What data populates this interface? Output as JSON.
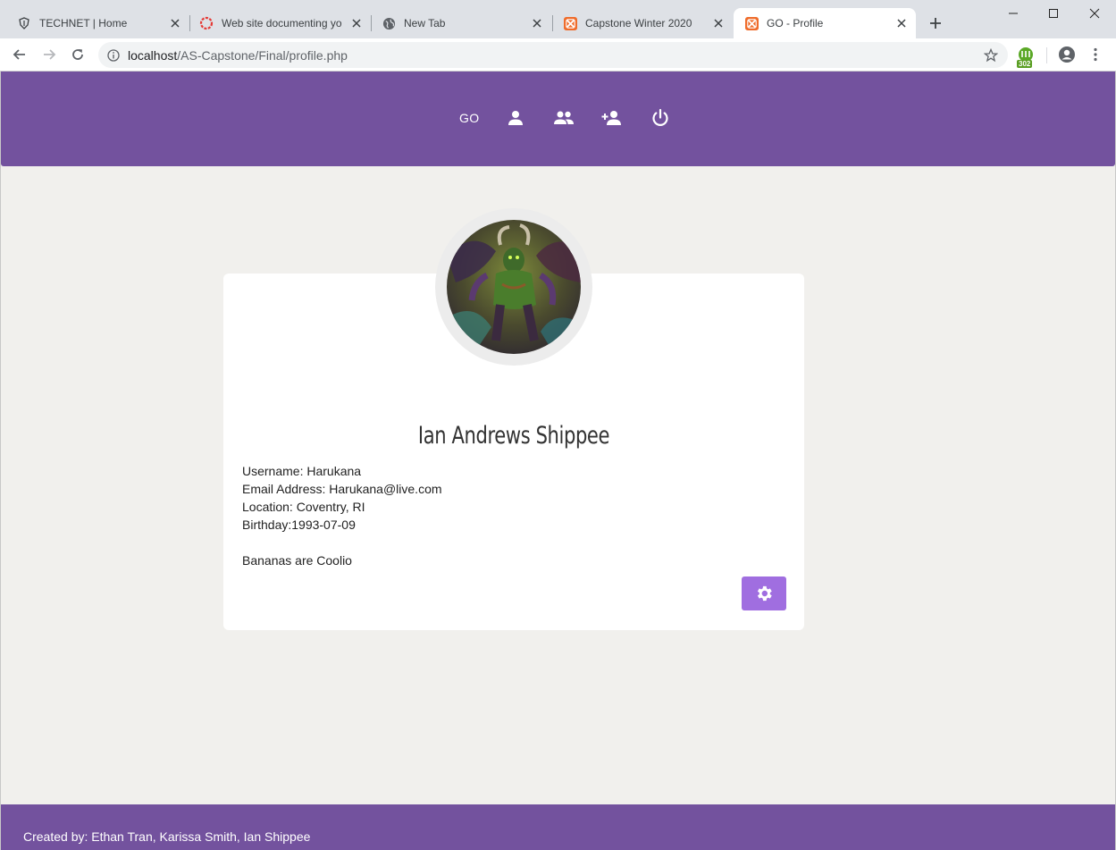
{
  "browser": {
    "tabs": [
      {
        "title": "TECHNET | Home",
        "favicon": "shield-icon",
        "active": false
      },
      {
        "title": "Web site documenting yo",
        "favicon": "ring-icon",
        "active": false
      },
      {
        "title": "New Tab",
        "favicon": "globe-icon",
        "active": false
      },
      {
        "title": "Capstone Winter 2020",
        "favicon": "xampp-icon",
        "active": false
      },
      {
        "title": "GO - Profile",
        "favicon": "xampp-icon",
        "active": true
      }
    ],
    "address": {
      "host": "localhost",
      "path": "/AS-Capstone/Final/profile.php"
    },
    "extension_badge": "302"
  },
  "nav": {
    "brand": "GO",
    "icons": [
      "profile-icon",
      "friends-icon",
      "add-friend-icon",
      "power-icon"
    ]
  },
  "profile": {
    "name": "Ian Andrews Shippee",
    "username_line": "Username: Harukana",
    "email_line": "Email Address: Harukana@live.com",
    "location_line": "Location: Coventry, RI",
    "birthday_line": "Birthday:1993-07-09",
    "bio": "Bananas are Coolio"
  },
  "footer": {
    "text": "Created by: Ethan Tran, Karissa Smith, Ian Shippee"
  },
  "colors": {
    "brand_purple": "#73529e",
    "button_purple": "#a06ee0",
    "page_bg": "#f1f0ed"
  }
}
